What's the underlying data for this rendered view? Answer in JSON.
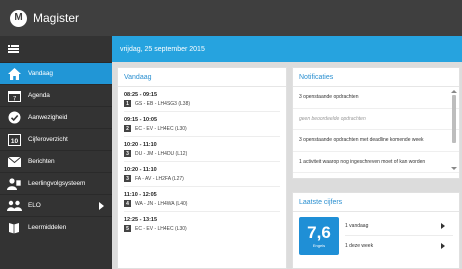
{
  "app": {
    "title": "Magister",
    "logo_glyph": "M"
  },
  "sidebar": {
    "items": [
      {
        "label": "Vandaag",
        "icon": "home-icon",
        "active": true
      },
      {
        "label": "Agenda",
        "icon": "calendar-icon"
      },
      {
        "label": "Aanwezigheid",
        "icon": "check-circle-icon"
      },
      {
        "label": "Cijferoverzicht",
        "icon": "grade-10-icon"
      },
      {
        "label": "Berichten",
        "icon": "envelope-icon"
      },
      {
        "label": "Leerlingvolgsysteem",
        "icon": "student-tracking-icon"
      },
      {
        "label": "ELO",
        "icon": "people-icon",
        "has_submenu": true
      },
      {
        "label": "Leermiddelen",
        "icon": "book-icon"
      }
    ]
  },
  "header": {
    "date": "vrijdag, 25 september 2015"
  },
  "vandaag": {
    "title": "Vandaag",
    "lessons": [
      {
        "time": "08:25 - 09:15",
        "hour": "1",
        "desc": "GS - EB - LH4SG3 (L38)"
      },
      {
        "time": "09:15 - 10:05",
        "hour": "2",
        "desc": "EC - EV - LH4EC (L30)"
      },
      {
        "time": "10:20 - 11:10",
        "hour": "3",
        "desc": "DU - JM - LH4DU (L12)"
      },
      {
        "time": "10:20 - 11:10",
        "hour": "3",
        "desc": "FA - AV - LH2FA (L27)"
      },
      {
        "time": "11:10 - 12:05",
        "hour": "4",
        "desc": "WA - JN - LH4WA (L40)"
      },
      {
        "time": "12:25 - 13:15",
        "hour": "5",
        "desc": "EC - EV - LH4EC (L30)"
      }
    ]
  },
  "notificaties": {
    "title": "Notificaties",
    "items": [
      {
        "text": "3 openstaande opdrachten",
        "muted": false
      },
      {
        "text": "geen beoordeelde opdrachten",
        "muted": true
      },
      {
        "text": "3 openstaande opdrachten met deadline komende week",
        "muted": false
      },
      {
        "text": "1 activiteit waarop nog ingeschreven moet of kan worden",
        "muted": false
      }
    ]
  },
  "cijfers": {
    "title": "Laatste cijfers",
    "grade": "7,6",
    "grade_subject": "Engels",
    "links": [
      {
        "label": "1 vandaag"
      },
      {
        "label": "1 deze week"
      }
    ]
  },
  "colors": {
    "accent": "#26a3df",
    "active_nav": "#2196d6",
    "sidebar": "#333333",
    "topbar": "#3f3f3f",
    "grade_tile": "#1f8fd6"
  }
}
